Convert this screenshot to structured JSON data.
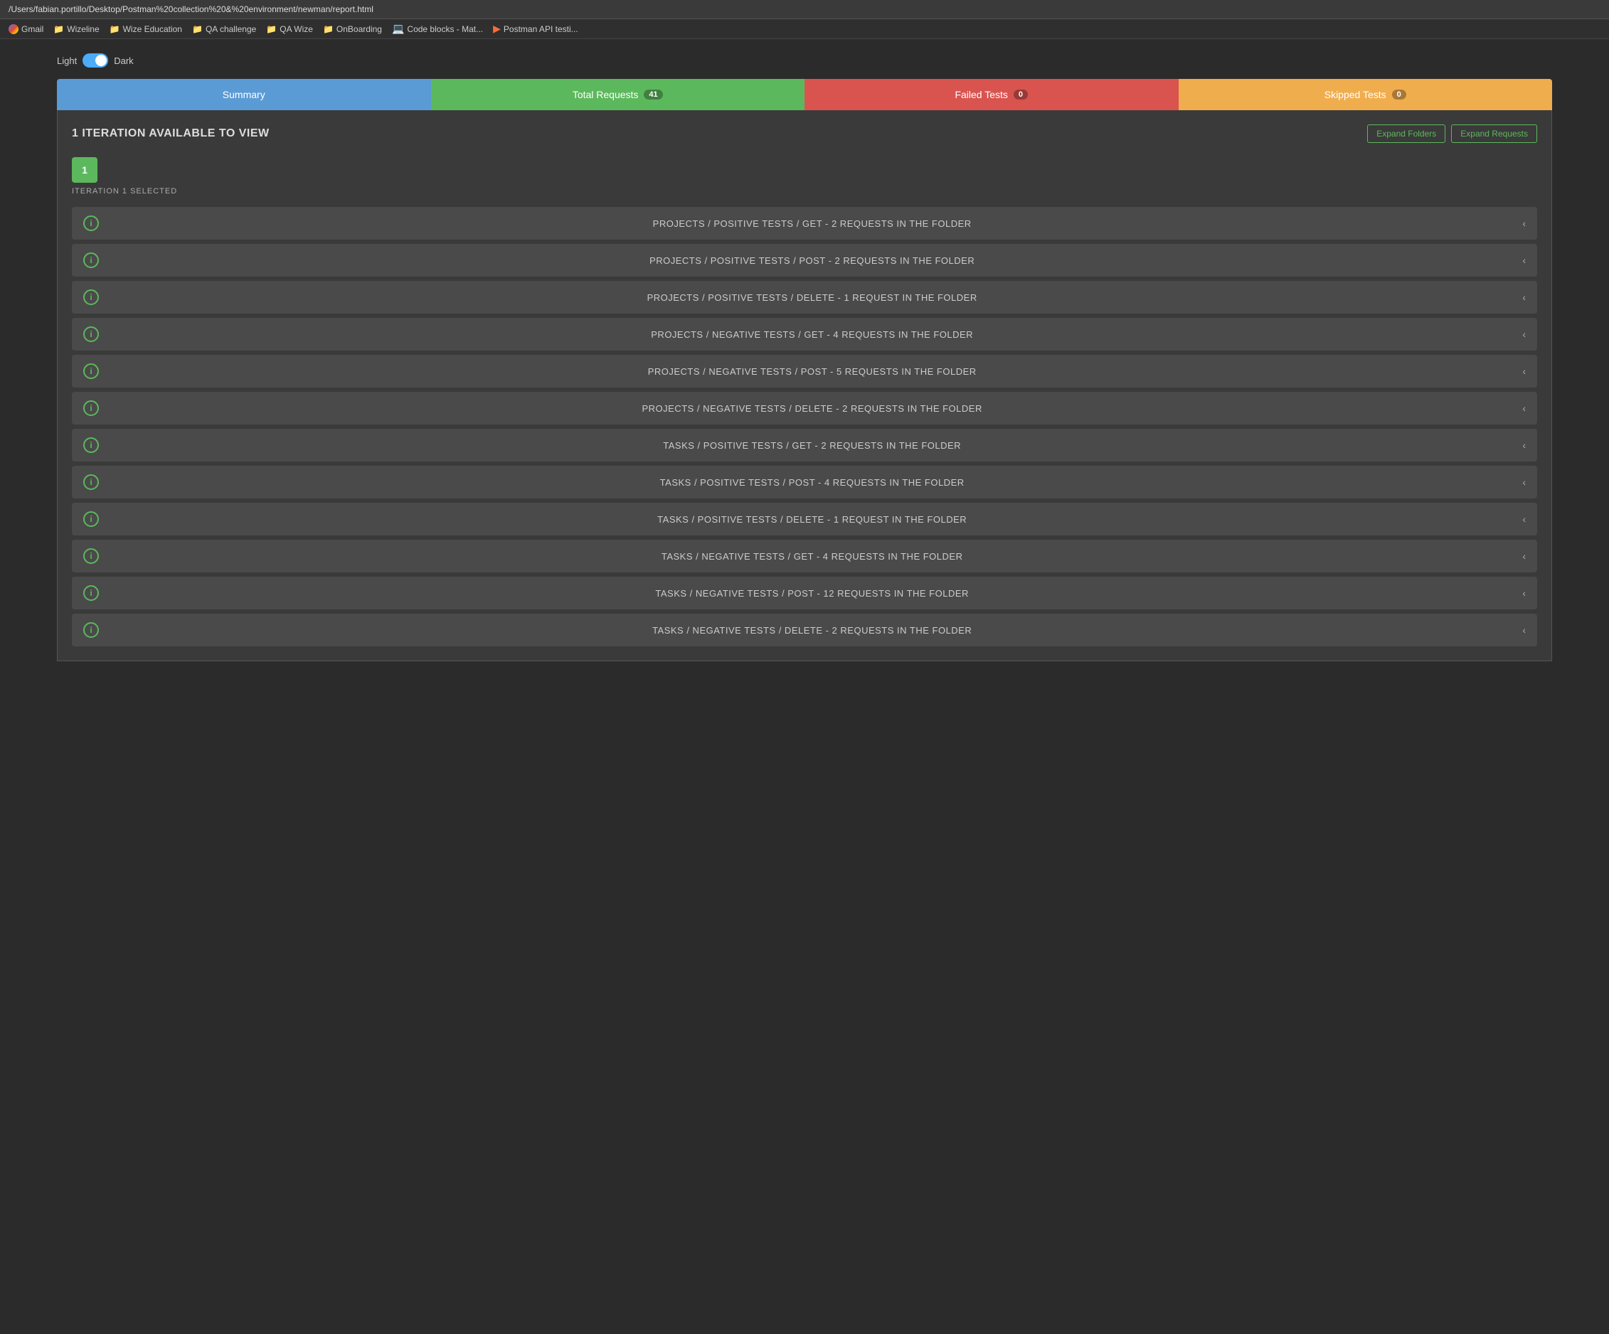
{
  "browser": {
    "url": "/Users/fabian.portillo/Desktop/Postman%20collection%20&%20environment/newman/report.html",
    "bookmarks": [
      {
        "label": "Gmail",
        "icon": "gmail"
      },
      {
        "label": "Wizeline",
        "icon": "folder"
      },
      {
        "label": "Wize Education",
        "icon": "folder"
      },
      {
        "label": "QA challenge",
        "icon": "folder"
      },
      {
        "label": "QA Wize",
        "icon": "folder"
      },
      {
        "label": "OnBoarding",
        "icon": "folder"
      },
      {
        "label": "Code blocks - Mat...",
        "icon": "code"
      },
      {
        "label": "Postman API testi...",
        "icon": "postman"
      }
    ]
  },
  "theme": {
    "light_label": "Light",
    "dark_label": "Dark"
  },
  "tabs": [
    {
      "id": "summary",
      "label": "Summary",
      "badge": null,
      "class": "tab-summary"
    },
    {
      "id": "total",
      "label": "Total Requests",
      "badge": "41",
      "class": "tab-total"
    },
    {
      "id": "failed",
      "label": "Failed Tests",
      "badge": "0",
      "class": "tab-failed"
    },
    {
      "id": "skipped",
      "label": "Skipped Tests",
      "badge": "0",
      "class": "tab-skipped"
    }
  ],
  "panel": {
    "title": "1 ITERATION AVAILABLE TO VIEW",
    "expand_folders_label": "Expand Folders",
    "expand_requests_label": "Expand Requests",
    "iteration_label": "ITERATION 1 SELECTED",
    "iteration_number": "1"
  },
  "folders": [
    {
      "name": "PROJECTS / POSITIVE TESTS / GET - 2 REQUESTS IN THE FOLDER"
    },
    {
      "name": "PROJECTS / POSITIVE TESTS / POST - 2 REQUESTS IN THE FOLDER"
    },
    {
      "name": "PROJECTS / POSITIVE TESTS / DELETE - 1 REQUEST IN THE FOLDER"
    },
    {
      "name": "PROJECTS / NEGATIVE TESTS / GET - 4 REQUESTS IN THE FOLDER"
    },
    {
      "name": "PROJECTS / NEGATIVE TESTS / POST - 5 REQUESTS IN THE FOLDER"
    },
    {
      "name": "PROJECTS / NEGATIVE TESTS / DELETE - 2 REQUESTS IN THE FOLDER"
    },
    {
      "name": "TASKS / POSITIVE TESTS / GET - 2 REQUESTS IN THE FOLDER"
    },
    {
      "name": "TASKS / POSITIVE TESTS / POST - 4 REQUESTS IN THE FOLDER"
    },
    {
      "name": "TASKS / POSITIVE TESTS / DELETE - 1 REQUEST IN THE FOLDER"
    },
    {
      "name": "TASKS / NEGATIVE TESTS / GET - 4 REQUESTS IN THE FOLDER"
    },
    {
      "name": "TASKS / NEGATIVE TESTS / POST - 12 REQUESTS IN THE FOLDER"
    },
    {
      "name": "TASKS / NEGATIVE TESTS / DELETE - 2 REQUESTS IN THE FOLDER"
    }
  ]
}
